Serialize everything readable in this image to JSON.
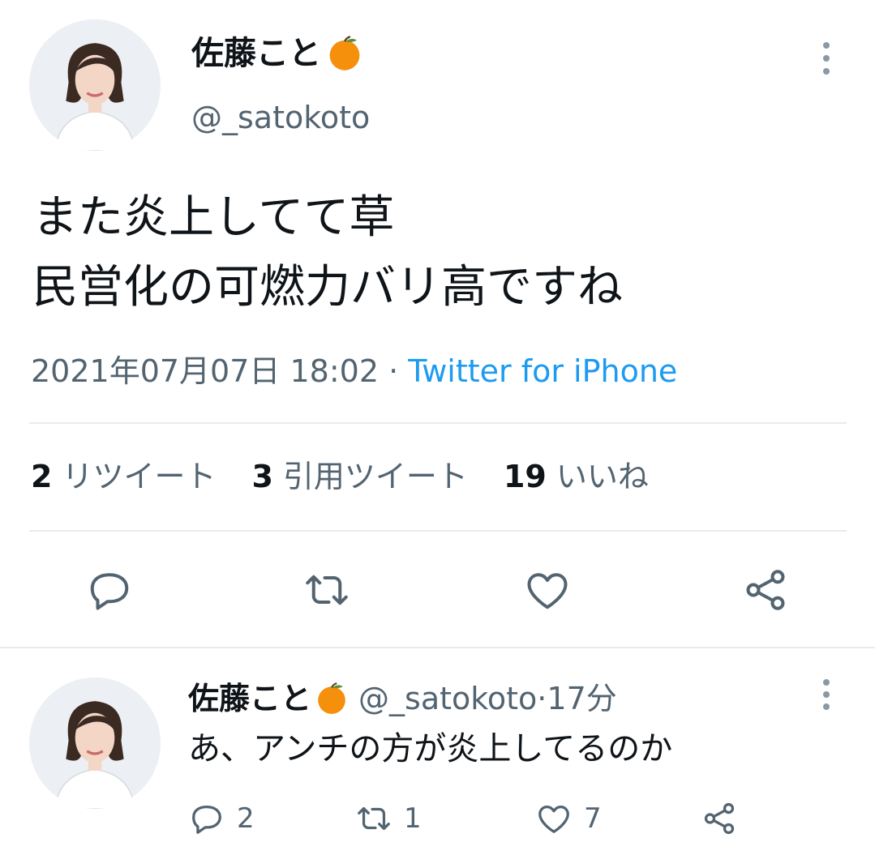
{
  "main_tweet": {
    "display_name": "佐藤こと",
    "name_emoji": "orange-emoji",
    "handle": "@_satokoto",
    "text_line1": "また炎上してて草",
    "text_line2": "民営化の可燃力バリ高ですね",
    "timestamp": "2021年07月07日 18:02",
    "separator": " · ",
    "source": "Twitter for iPhone",
    "stats": {
      "retweets_count": "2",
      "retweets_label": "リツイート",
      "quotes_count": "3",
      "quotes_label": "引用ツイート",
      "likes_count": "19",
      "likes_label": "いいね"
    },
    "icons": [
      "reply-icon",
      "retweet-icon",
      "like-icon",
      "share-icon"
    ]
  },
  "reply_tweet": {
    "display_name": "佐藤こと",
    "handle": "@_satokoto",
    "time_sep": " · ",
    "time": "17分",
    "text": "あ、アンチの方が炎上してるのか",
    "reply_count": "2",
    "retweet_count": "1",
    "like_count": "7"
  },
  "colors": {
    "text_primary": "#0f1419",
    "text_secondary": "#536471",
    "link": "#1d9bf0",
    "divider": "#e6ecf0"
  }
}
